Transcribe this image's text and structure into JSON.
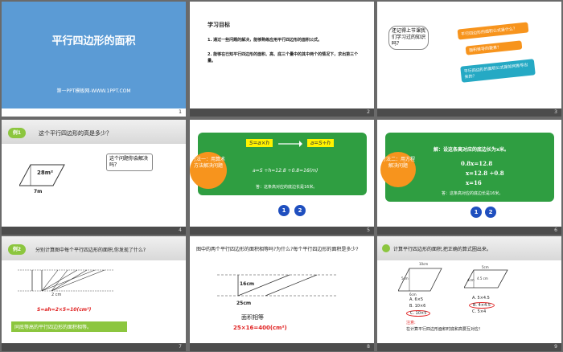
{
  "slides": {
    "s1": {
      "title": "平行四边形的面积",
      "brand": "第一PPT模板网-WWW.1PPT.COM",
      "num": "1",
      "bg": "#5b9bd5"
    },
    "s2": {
      "heading": "学习目标",
      "goal1": "1. 通过一些问题的解决，能够熟练应用平行四边形的面积公式。",
      "goal2": "2. 能够在已知平行四边形的面积、高、底三个量中的其中两个的情况下，求出第三个量。",
      "num": "2"
    },
    "s3": {
      "ask": "还记得上节课我们学习过的知识吗？",
      "q1": "平行四边形的面积公式是什么？",
      "q2": "面积推导的要素？",
      "q3": "平行四边形的面积公式是如何推导出来的？",
      "num": "3"
    },
    "s4": {
      "badge": "例1",
      "question": "这个平行四边形的高是多少？",
      "area": "28m²",
      "base": "7m",
      "callout": "这个问题你会解决吗？",
      "num": "4"
    },
    "s5": {
      "method": "方法一：用算术方法解决问题",
      "formula1": "S=a×h",
      "formula2": "a=S÷h",
      "calc": "a=S ÷h=12.8 ÷0.8=16(m)",
      "answer": "答：这条高对应的底边长是16米。",
      "n1": "1",
      "n2": "2",
      "num": "5"
    },
    "s6": {
      "method": "方法二：用方程解决问题",
      "solve": "解：设这条高对应的底边长为x米。",
      "eq1": "0.8x=12.8",
      "eq2": "x=12.8 ÷0.8",
      "eq3": "x=16",
      "answer": "答：这条高对应的底边长是16米。",
      "n1": "1",
      "n2": "2",
      "num": "6"
    },
    "s7": {
      "badge": "例2",
      "question": "分别计算图中每个平行四边形的面积,你发现了什么?",
      "dim": "2 cm",
      "result": "S=ah=2×5=10(cm²)",
      "conclusion": "同底等高的平行四边形的面积相等。",
      "num": "7"
    },
    "s8": {
      "question": "图中的两个平行四边形的面积相等吗?为什么?每个平行四边形的面积是多少?",
      "height": "16cm",
      "base": "25cm",
      "equal": "面积相等",
      "result": "25×16=400(cm²)",
      "num": "8"
    },
    "s9": {
      "question": "计算平行四边形的面积,把正确的算式圈出来。",
      "d1": "10cm",
      "d2": "5cm",
      "d3": "6cm",
      "d4": "4.5 cm",
      "d5": "4cm",
      "d6": "5cm",
      "a1": "A. 6×5",
      "b1": "B. 10×6",
      "c1": "C. 10×5",
      "a2": "A. 5×4.5",
      "b2": "B. 4×4.5",
      "c2": "C. 5×4",
      "note": "注意:",
      "tip": "在计算平行四边形面积时底和高要互对应！",
      "num": "9"
    }
  }
}
